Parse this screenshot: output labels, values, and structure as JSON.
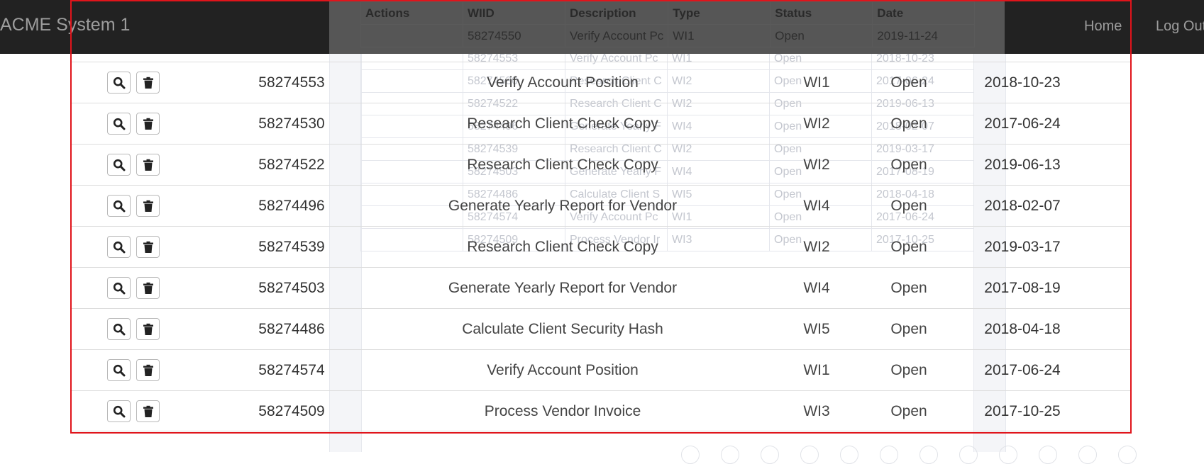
{
  "navbar": {
    "brand": "ACME System 1",
    "links": [
      "Home",
      "Log Out"
    ]
  },
  "background_table": {
    "headers": [
      "Actions",
      "WIID",
      "Description",
      "Type",
      "Status",
      "Date"
    ],
    "rows": [
      [
        "",
        "58274550",
        "Verify Account Pc",
        "WI1",
        "Open",
        "2019-11-24"
      ],
      [
        "",
        "58274553",
        "Verify Account Pc",
        "WI1",
        "Open",
        "2018-10-23"
      ],
      [
        "",
        "58274530",
        "Research Client C",
        "WI2",
        "Open",
        "2017-06-24"
      ],
      [
        "",
        "58274522",
        "Research Client C",
        "WI2",
        "Open",
        "2019-06-13"
      ],
      [
        "",
        "58274496",
        "Generate Yearly F",
        "WI4",
        "Open",
        "2018-02-07"
      ],
      [
        "",
        "58274539",
        "Research Client C",
        "WI2",
        "Open",
        "2019-03-17"
      ],
      [
        "",
        "58274503",
        "Generate Yearly F",
        "WI4",
        "Open",
        "2017-08-19"
      ],
      [
        "",
        "58274486",
        "Calculate Client S",
        "WI5",
        "Open",
        "2018-04-18"
      ],
      [
        "",
        "58274574",
        "Verify Account Pc",
        "WI1",
        "Open",
        "2017-06-24"
      ],
      [
        "",
        "58274509",
        "Process Vendor Ir",
        "WI3",
        "Open",
        "2017-10-25"
      ]
    ]
  },
  "work_items": {
    "rows": [
      {
        "wiid": "58274553",
        "description": "Verify Account Position",
        "type": "WI1",
        "status": "Open",
        "date": "2018-10-23"
      },
      {
        "wiid": "58274530",
        "description": "Research Client Check Copy",
        "type": "WI2",
        "status": "Open",
        "date": "2017-06-24"
      },
      {
        "wiid": "58274522",
        "description": "Research Client Check Copy",
        "type": "WI2",
        "status": "Open",
        "date": "2019-06-13"
      },
      {
        "wiid": "58274496",
        "description": "Generate Yearly Report for Vendor",
        "type": "WI4",
        "status": "Open",
        "date": "2018-02-07"
      },
      {
        "wiid": "58274539",
        "description": "Research Client Check Copy",
        "type": "WI2",
        "status": "Open",
        "date": "2019-03-17"
      },
      {
        "wiid": "58274503",
        "description": "Generate Yearly Report for Vendor",
        "type": "WI4",
        "status": "Open",
        "date": "2017-08-19"
      },
      {
        "wiid": "58274486",
        "description": "Calculate Client Security Hash",
        "type": "WI5",
        "status": "Open",
        "date": "2018-04-18"
      },
      {
        "wiid": "58274574",
        "description": "Verify Account Position",
        "type": "WI1",
        "status": "Open",
        "date": "2017-06-24"
      },
      {
        "wiid": "58274509",
        "description": "Process Vendor Invoice",
        "type": "WI3",
        "status": "Open",
        "date": "2017-10-25"
      }
    ],
    "row_actions": {
      "view_icon": "search-icon",
      "delete_icon": "trash-icon"
    }
  },
  "colors": {
    "navbar_bg": "#222222",
    "navbar_text": "#9d9d9d",
    "highlight_border": "#e0141b"
  }
}
